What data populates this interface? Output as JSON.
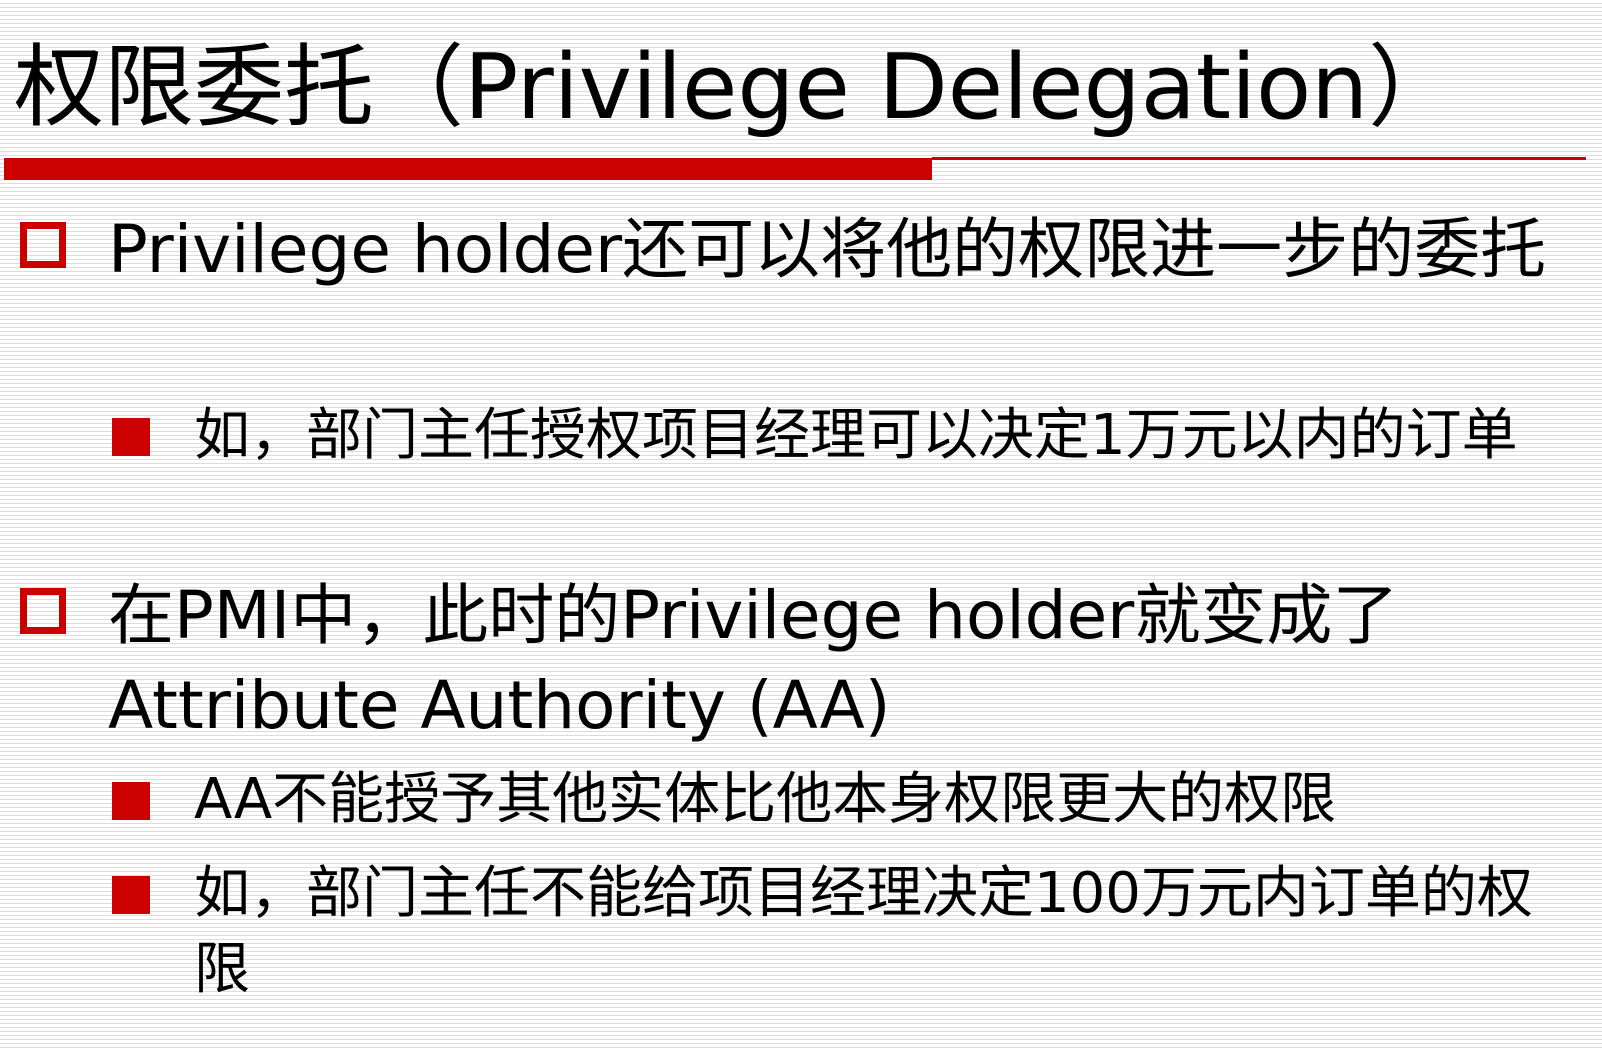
{
  "slide": {
    "title": "权限委托（Privilege Delegation）",
    "bullets": [
      {
        "level": 1,
        "text": "Privilege holder还可以将他的权限进一步的委托"
      },
      {
        "level": 2,
        "text": "如，部门主任授权项目经理可以决定1万元以内的订单"
      },
      {
        "level": 1,
        "text": "在PMI中，此时的Privilege holder就变成了Attribute Authority (AA)"
      },
      {
        "level": 2,
        "text": "AA不能授予其他实体比他本身权限更大的权限"
      },
      {
        "level": 2,
        "text": "如，部门主任不能给项目经理决定100万元内订单的权限"
      }
    ],
    "colors": {
      "accent": "#cc0000",
      "text": "#000000",
      "background_line": "#dcdcdc"
    }
  }
}
